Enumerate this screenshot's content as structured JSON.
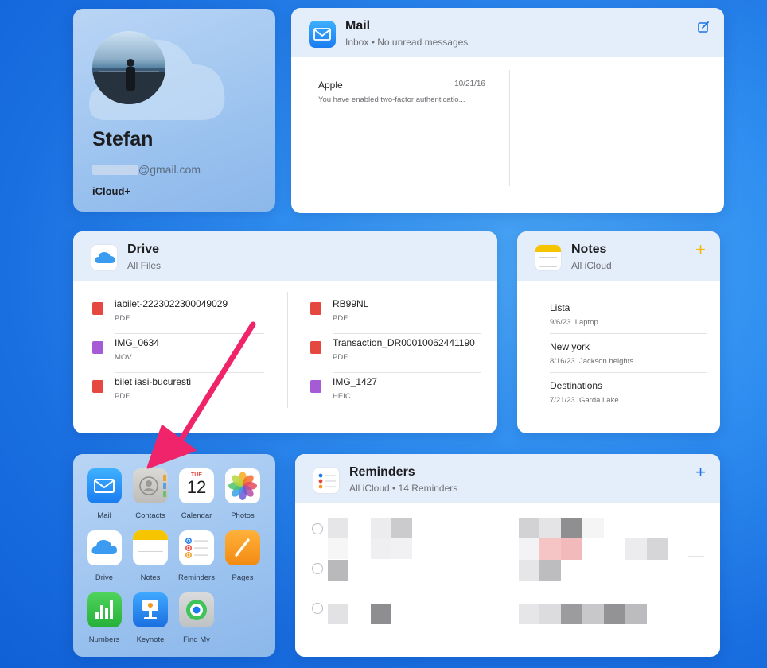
{
  "profile": {
    "name": "Stefan",
    "email_visible": "@gmail.com",
    "plan": "iCloud+"
  },
  "mail": {
    "title": "Mail",
    "subtitle": "Inbox • No unread messages",
    "icon": "envelope-icon",
    "action_icon": "compose-icon",
    "messages": [
      {
        "from": "Apple",
        "date": "10/21/16",
        "preview": "You have enabled two-factor authenticatio..."
      }
    ]
  },
  "drive": {
    "title": "Drive",
    "subtitle": "All Files",
    "icon": "cloud-icon",
    "left_files": [
      {
        "name": "iabilet-2223022300049029",
        "type": "PDF",
        "color": "#e5483f"
      },
      {
        "name": "IMG_0634",
        "type": "MOV",
        "color": "#a65bd6"
      },
      {
        "name": "bilet iasi-bucuresti",
        "type": "PDF",
        "color": "#e5483f"
      }
    ],
    "right_files": [
      {
        "name": "RB99NL",
        "type": "PDF",
        "color": "#e5483f"
      },
      {
        "name": "Transaction_DR00010062441190",
        "type": "PDF",
        "color": "#e5483f"
      },
      {
        "name": "IMG_1427",
        "type": "HEIC",
        "color": "#a65bd6"
      }
    ]
  },
  "notes": {
    "title": "Notes",
    "subtitle": "All iCloud",
    "action": "+",
    "accent": "#f5c400",
    "items": [
      {
        "title": "Lista",
        "date": "9/6/23",
        "preview": "Laptop"
      },
      {
        "title": "New york",
        "date": "8/16/23",
        "preview": "Jackson heights"
      },
      {
        "title": "Destinations",
        "date": "7/21/23",
        "preview": "Garda Lake"
      }
    ]
  },
  "apps": {
    "items": [
      {
        "label": "Mail",
        "icon": "mail-app-icon"
      },
      {
        "label": "Contacts",
        "icon": "contacts-app-icon"
      },
      {
        "label": "Calendar",
        "icon": "calendar-app-icon"
      },
      {
        "label": "Photos",
        "icon": "photos-app-icon"
      },
      {
        "label": "Drive",
        "icon": "drive-app-icon"
      },
      {
        "label": "Notes",
        "icon": "notes-app-icon"
      },
      {
        "label": "Reminders",
        "icon": "reminders-app-icon"
      },
      {
        "label": "Pages",
        "icon": "pages-app-icon"
      },
      {
        "label": "Numbers",
        "icon": "numbers-app-icon"
      },
      {
        "label": "Keynote",
        "icon": "keynote-app-icon"
      },
      {
        "label": "Find My",
        "icon": "find-my-app-icon"
      }
    ],
    "calendar_day": "TUE",
    "calendar_date": "12"
  },
  "reminders": {
    "title": "Reminders",
    "subtitle": "All iCloud • 14 Reminders",
    "action": "+",
    "accent": "#1a73e8"
  },
  "annotation": {
    "arrow_color": "#f0246a",
    "points_to": "Contacts"
  }
}
